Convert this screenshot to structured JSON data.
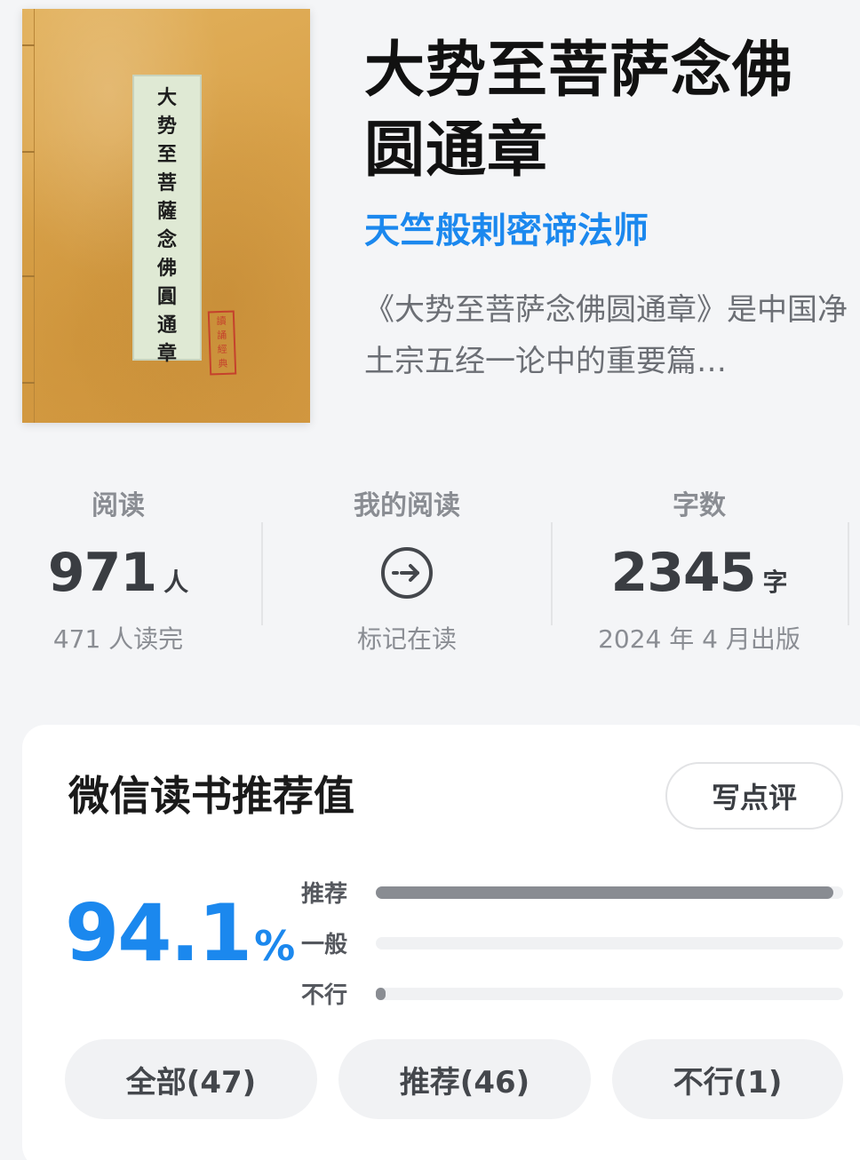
{
  "book": {
    "title": "大势至菩萨念佛圆通章",
    "author": "天竺般剌密谛法师",
    "description": "《大势至菩萨念佛圆通章》是中国净土宗五经一论中的重要篇…",
    "cover_label_chars": [
      "大",
      "势",
      "至",
      "菩",
      "薩",
      "念",
      "佛",
      "圓",
      "通",
      "章"
    ],
    "cover_seal_chars": [
      "讀",
      "誦",
      "經",
      "典"
    ]
  },
  "stats": {
    "reading": {
      "label": "阅读",
      "value": "971",
      "unit": "人",
      "sub": "471 人读完"
    },
    "my_reading": {
      "label": "我的阅读",
      "icon": "arrow-right-circle-icon",
      "sub": "标记在读"
    },
    "words": {
      "label": "字数",
      "value": "2345",
      "unit": "字",
      "sub": "2024 年 4 月出版"
    }
  },
  "recommend": {
    "title": "微信读书推荐值",
    "write_button": "写点评",
    "score": "94.1",
    "score_unit": "%",
    "bars": [
      {
        "label": "推荐",
        "fraction": 0.98
      },
      {
        "label": "一般",
        "fraction": 0.0
      },
      {
        "label": "不行",
        "fraction": 0.02
      }
    ],
    "filters": [
      "全部(47)",
      "推荐(46)",
      "不行(1)"
    ]
  },
  "colors": {
    "accent": "#1b88ee",
    "bar_fill": "#898c92",
    "bar_track": "#f0f1f3"
  }
}
